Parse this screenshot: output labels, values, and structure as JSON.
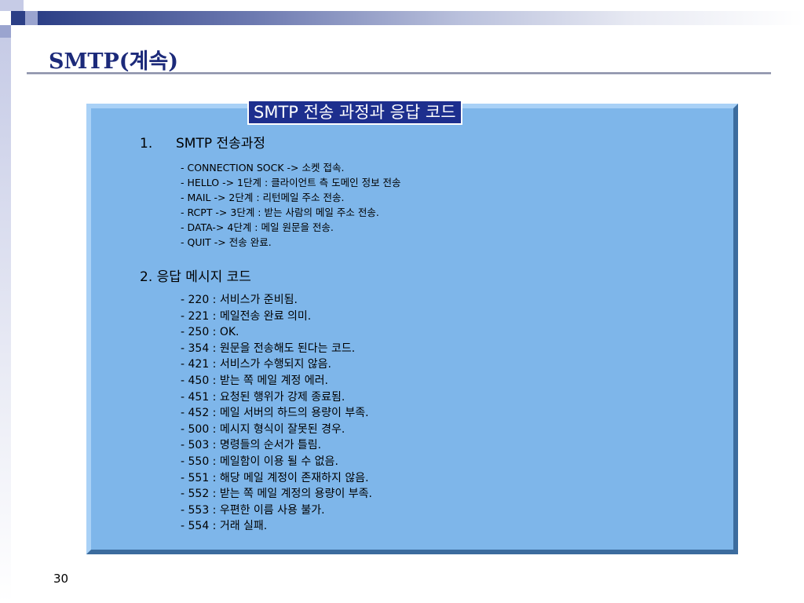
{
  "slide": {
    "title": "SMTP(계속)",
    "page_number": "30"
  },
  "panel": {
    "header": "SMTP 전송 과정과 응답 코드",
    "section1": {
      "number": "1.",
      "title": "SMTP 전송과정",
      "items": [
        "- CONNECTION SOCK -> 소켓 접속.",
        "- HELLO -> 1단계 : 클라이언트 측 도메인 정보 전송",
        "- MAIL -> 2단계 : 리턴메일 주소 전송.",
        "- RCPT -> 3단계 : 받는 사람의 메일 주소 전송.",
        "- DATA-> 4단계 : 메일 원문을 전송.",
        "- QUIT -> 전송 완료."
      ]
    },
    "section2": {
      "title": "2. 응답 메시지 코드",
      "items": [
        "- 220 : 서비스가 준비됨.",
        "- 221 : 메일전송 완료 의미.",
        "- 250 : OK.",
        "- 354 : 원문을 전송해도 된다는 코드.",
        "- 421 : 서비스가 수행되지 않음.",
        "- 450 : 받는 쪽 메일 계정 에러.",
        "- 451 : 요청된 행위가 강제 종료됨.",
        "- 452 : 메일 서버의 하드의 용량이 부족.",
        "- 500 : 메시지 형식이 잘못된 경우.",
        "- 503 : 명령들의 순서가 틀림.",
        "- 550 : 메일함이 이용 될 수 없음.",
        "- 551 : 해당 메일 계정이 존재하지 않음.",
        "- 552 : 받는 쪽 메일 계정의 용량이 부족.",
        "- 553 : 우편한 이름 사용 불가.",
        "- 554 : 거래 실패."
      ]
    }
  },
  "colors": {
    "title": "#1c2a7a",
    "panel_fill": "#7eb6ea",
    "header_fill": "#1d2f8e"
  }
}
